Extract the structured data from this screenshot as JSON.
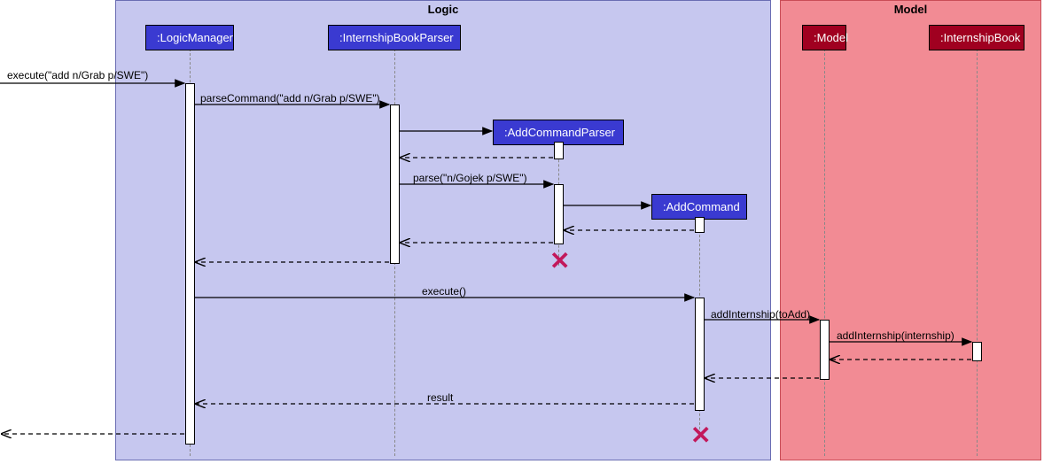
{
  "frames": {
    "logic": {
      "label": "Logic"
    },
    "model": {
      "label": "Model"
    }
  },
  "participants": {
    "logicManager": ":LogicManager",
    "ibParser": ":InternshipBookParser",
    "addCmdParser": ":AddCommandParser",
    "addCmd": ":AddCommand",
    "model": ":Model",
    "internshipBook": ":InternshipBook"
  },
  "messages": {
    "execute_in": "execute(\"add n/Grab p/SWE\")",
    "parseCommand": "parseCommand(\"add n/Grab p/SWE\")",
    "parse": "parse(\"n/Gojek p/SWE\")",
    "execute2": "execute()",
    "addInternship1": "addInternship(toAdd)",
    "addInternship2": "addInternship(internship)",
    "result": "result"
  },
  "colors": {
    "logicFrameBg": "#c6c7ef",
    "logicFrameBorder": "#6a6db3",
    "modelFrameBg": "#f28b94",
    "modelFrameBorder": "#c94d57",
    "logicBox": "#3a3ad1",
    "modelBox": "#a00020"
  },
  "chart_data": {
    "type": "sequence-diagram",
    "frames": [
      {
        "name": "Logic",
        "participants": [
          ":LogicManager",
          ":InternshipBookParser",
          ":AddCommandParser",
          ":AddCommand"
        ]
      },
      {
        "name": "Model",
        "participants": [
          ":Model",
          ":InternshipBook"
        ]
      }
    ],
    "messages": [
      {
        "from": "external",
        "to": ":LogicManager",
        "label": "execute(\"add n/Grab p/SWE\")",
        "type": "sync"
      },
      {
        "from": ":LogicManager",
        "to": ":InternshipBookParser",
        "label": "parseCommand(\"add n/Grab p/SWE\")",
        "type": "sync"
      },
      {
        "from": ":InternshipBookParser",
        "to": ":AddCommandParser",
        "label": "",
        "type": "create"
      },
      {
        "from": ":AddCommandParser",
        "to": ":InternshipBookParser",
        "label": "",
        "type": "return"
      },
      {
        "from": ":InternshipBookParser",
        "to": ":AddCommandParser",
        "label": "parse(\"n/Gojek p/SWE\")",
        "type": "sync"
      },
      {
        "from": ":AddCommandParser",
        "to": ":AddCommand",
        "label": "",
        "type": "create"
      },
      {
        "from": ":AddCommand",
        "to": ":AddCommandParser",
        "label": "",
        "type": "return"
      },
      {
        "from": ":AddCommandParser",
        "to": ":InternshipBookParser",
        "label": "",
        "type": "return"
      },
      {
        "from": ":InternshipBookParser",
        "to": ":LogicManager",
        "label": "",
        "type": "return"
      },
      {
        "from": ":LogicManager",
        "to": ":AddCommand",
        "label": "execute()",
        "type": "sync"
      },
      {
        "from": ":AddCommand",
        "to": ":Model",
        "label": "addInternship(toAdd)",
        "type": "sync"
      },
      {
        "from": ":Model",
        "to": ":InternshipBook",
        "label": "addInternship(internship)",
        "type": "sync"
      },
      {
        "from": ":InternshipBook",
        "to": ":Model",
        "label": "",
        "type": "return"
      },
      {
        "from": ":Model",
        "to": ":AddCommand",
        "label": "",
        "type": "return"
      },
      {
        "from": ":AddCommand",
        "to": ":LogicManager",
        "label": "result",
        "type": "return"
      },
      {
        "from": ":LogicManager",
        "to": "external",
        "label": "",
        "type": "return"
      }
    ],
    "destroyed": [
      ":AddCommandParser",
      ":AddCommand"
    ]
  }
}
